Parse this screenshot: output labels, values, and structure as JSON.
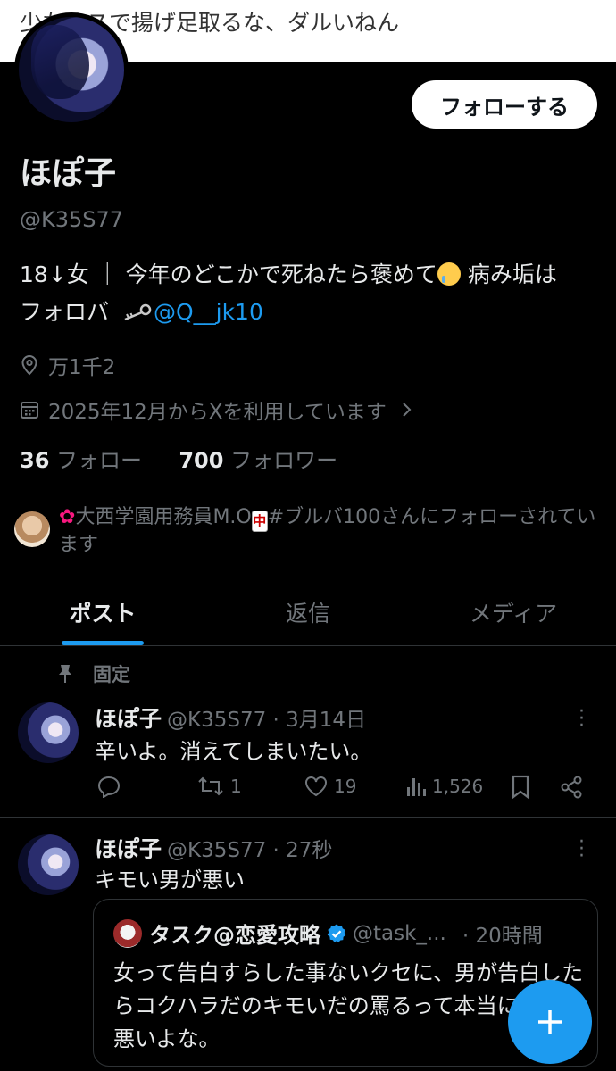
{
  "banner": {
    "text": "少なめスで揚げ足取るな、ダルいねん"
  },
  "profile": {
    "follow_label": "フォローする",
    "name": "ほぽ子",
    "handle": "@K35S77",
    "bio_line1": "18↓女 ｜ 今年のどこかで死ねたら褒めて",
    "bio_line1_tail": " 病み垢は",
    "bio_line2": "フォロバ ",
    "bio_link": "@Q__jk10",
    "location": "万1千2",
    "joined": "2025年12月からXを利用しています",
    "following_count": "36",
    "following_label": "フォロー",
    "followers_count": "700",
    "followers_label": "フォロワー",
    "followed_by_name1": "大西学園用務員M.O",
    "mahjong_char": "中",
    "followed_by_name2": "#ブルバ100さんにフォローされています"
  },
  "tabs": [
    {
      "label": "ポスト",
      "active": true
    },
    {
      "label": "返信",
      "active": false
    },
    {
      "label": "メディア",
      "active": false
    }
  ],
  "pinned_label": "固定",
  "posts": [
    {
      "name": "ほぽ子",
      "meta": "@K35S77 · 3月14日",
      "text": "辛いよ。消えてしまいたい。",
      "reposts": "1",
      "likes": "19",
      "views": "1,526"
    },
    {
      "name": "ほぽ子",
      "meta": "@K35S77 · 27秒",
      "text": "キモい男が悪い",
      "quote": {
        "name": "タスク@恋愛攻略",
        "handle": "@task_...",
        "time": "· 20時間",
        "text": "女って告白すらした事ないクセに、男が告白したらコクハラだのキモいだの罵るって本当に気持ち悪いよな。"
      }
    }
  ],
  "colors": {
    "accent": "#1d9bf0",
    "muted": "#71767b",
    "text": "#e7e9ea",
    "background": "#000000"
  },
  "icons": [
    "location-icon",
    "calendar-icon",
    "chevron-right-icon",
    "pin-icon",
    "reply-icon",
    "repost-icon",
    "like-icon",
    "views-icon",
    "bookmark-icon",
    "share-icon",
    "verified-icon",
    "compose-plus-icon",
    "more-icon",
    "key-icon"
  ]
}
